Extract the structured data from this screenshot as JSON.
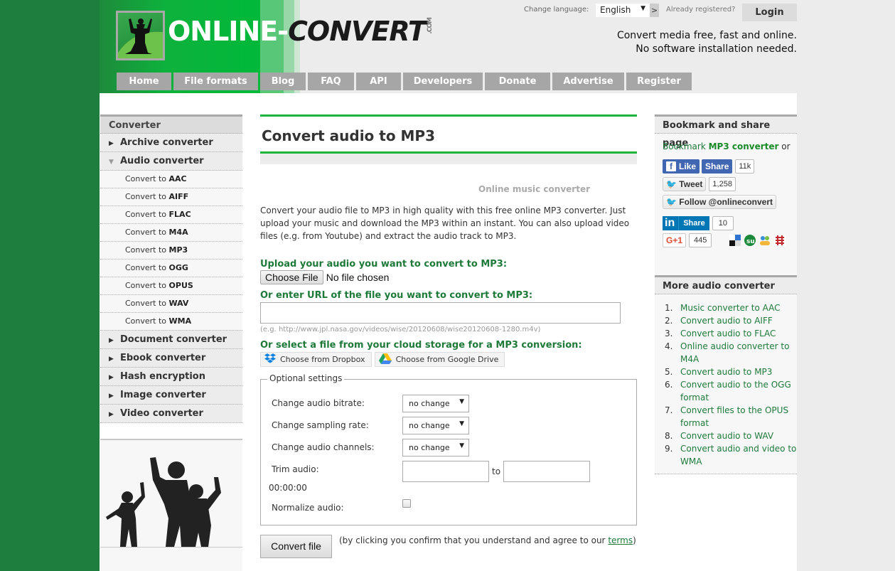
{
  "header": {
    "logo": {
      "part1": "ONLINE-",
      "part2": "CONVERT",
      "tld": ".COM"
    },
    "change_language_label": "Change language:",
    "language_selected": "English",
    "language_go": ">",
    "already_registered": "Already registered?",
    "login_label": "Login",
    "slogan_line1": "Convert media free, fast and online.",
    "slogan_line2": "No software installation needed."
  },
  "nav": [
    {
      "label": "Home"
    },
    {
      "label": "File formats"
    },
    {
      "label": "Blog"
    },
    {
      "label": "FAQ"
    },
    {
      "label": "API"
    },
    {
      "label": "Developers"
    },
    {
      "label": "Donate"
    },
    {
      "label": "Advertise"
    },
    {
      "label": "Register"
    }
  ],
  "left_sidebar": {
    "heading": "Converter",
    "categories_top": [
      {
        "label": "Archive converter",
        "expanded": false
      },
      {
        "label": "Audio converter",
        "expanded": true
      }
    ],
    "audio_items": [
      {
        "prefix": "Convert to ",
        "format": "AAC"
      },
      {
        "prefix": "Convert to ",
        "format": "AIFF"
      },
      {
        "prefix": "Convert to ",
        "format": "FLAC"
      },
      {
        "prefix": "Convert to ",
        "format": "M4A"
      },
      {
        "prefix": "Convert to ",
        "format": "MP3"
      },
      {
        "prefix": "Convert to ",
        "format": "OGG"
      },
      {
        "prefix": "Convert to ",
        "format": "OPUS"
      },
      {
        "prefix": "Convert to ",
        "format": "WAV"
      },
      {
        "prefix": "Convert to ",
        "format": "WMA"
      }
    ],
    "categories_bottom": [
      {
        "label": "Document converter"
      },
      {
        "label": "Ebook converter"
      },
      {
        "label": "Hash encryption"
      },
      {
        "label": "Image converter"
      },
      {
        "label": "Video converter"
      }
    ]
  },
  "main": {
    "title": "Convert audio to MP3",
    "subtitle": "Online music converter",
    "description": "Convert your audio file to MP3 in high quality with this free online MP3 converter. Just upload your music and download the MP3 within an instant. You can also upload video files (e.g. from Youtube) and extract the audio track to MP3.",
    "upload_label": "Upload your audio you want to convert to MP3:",
    "choose_file": "Choose File",
    "no_file": "No file chosen",
    "url_label": "Or enter URL of the file you want to convert to MP3:",
    "url_value": "",
    "url_example": "(e.g. http://www.jpl.nasa.gov/videos/wise/20120608/wise20120608-1280.m4v)",
    "cloud_label": "Or select a file from your cloud storage for a MP3 conversion:",
    "dropbox_label": "Choose from Dropbox",
    "gdrive_label": "Choose from Google Drive",
    "optional": {
      "legend": "Optional settings",
      "bitrate_label": "Change audio bitrate:",
      "bitrate_value": "no change",
      "sampling_label": "Change sampling rate:",
      "sampling_value": "no change",
      "channels_label": "Change audio channels:",
      "channels_value": "no change",
      "trim_label": "Trim audio:",
      "trim_to": "to",
      "trim_start": "",
      "trim_end": "",
      "trim_time": "00:00:00",
      "normalize_label": "Normalize audio:",
      "normalize_checked": false
    },
    "convert_label": "Convert file",
    "convert_note_before": "(by clicking you confirm that you understand and agree to our ",
    "terms_link": "terms",
    "convert_note_after": ")"
  },
  "right_sidebar": {
    "bookmark_heading": "Bookmark and share page",
    "bookmark_prefix": "Bookmark ",
    "bookmark_bold": "MP3 converter",
    "bookmark_suffix": " or",
    "fb_like": "Like",
    "fb_share": "Share",
    "fb_count": "11k",
    "tweet": "Tweet",
    "tweet_count": "1,258",
    "follow": "Follow @onlineconvert",
    "li_share": "Share",
    "li_count": "10",
    "gplus": "G+1",
    "gplus_count": "445",
    "more_heading": "More audio converter",
    "more_items": [
      "Music converter to AAC",
      "Convert audio to AIFF",
      "Convert audio to FLAC",
      "Online audio converter to M4A",
      "Convert audio to MP3",
      "Convert audio to the OGG format",
      "Convert files to the OPUS format",
      "Convert audio to WAV",
      "Convert audio and video to WMA"
    ]
  }
}
